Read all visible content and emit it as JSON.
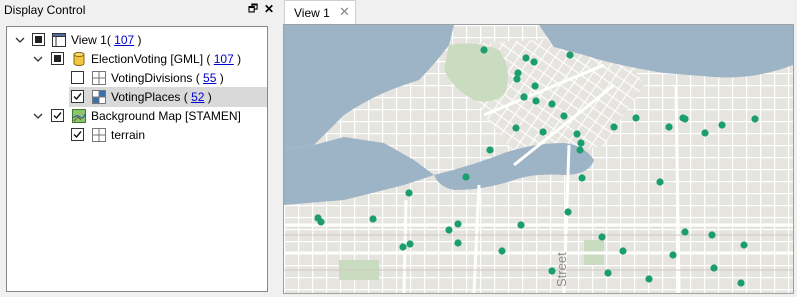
{
  "dock": {
    "title": "Display Control",
    "float_glyph": "🗗",
    "close_glyph": "✕"
  },
  "tree": {
    "view": {
      "label": "View 1",
      "count": "107",
      "open": "( ",
      "close": " )"
    },
    "election": {
      "label": "ElectionVoting [GML]",
      "count": "107",
      "open": " ( ",
      "close": " )"
    },
    "divisions": {
      "label": "VotingDivisions",
      "count": "55",
      "open": " ( ",
      "close": " )"
    },
    "places": {
      "label": "VotingPlaces",
      "count": "52",
      "open": " ( ",
      "close": " )"
    },
    "background": {
      "label": "Background Map [STAMEN]"
    },
    "terrain": {
      "label": "terrain"
    }
  },
  "view_tab": {
    "label": "View 1",
    "close_glyph": "✕"
  },
  "map": {
    "street_text": "Street",
    "colors": {
      "water": "#9db4c7",
      "land": "#e6e4df",
      "park": "#c9dcc0",
      "road": "#ffffff",
      "point": "#1a9e6e"
    },
    "point_count_visible": 52
  }
}
